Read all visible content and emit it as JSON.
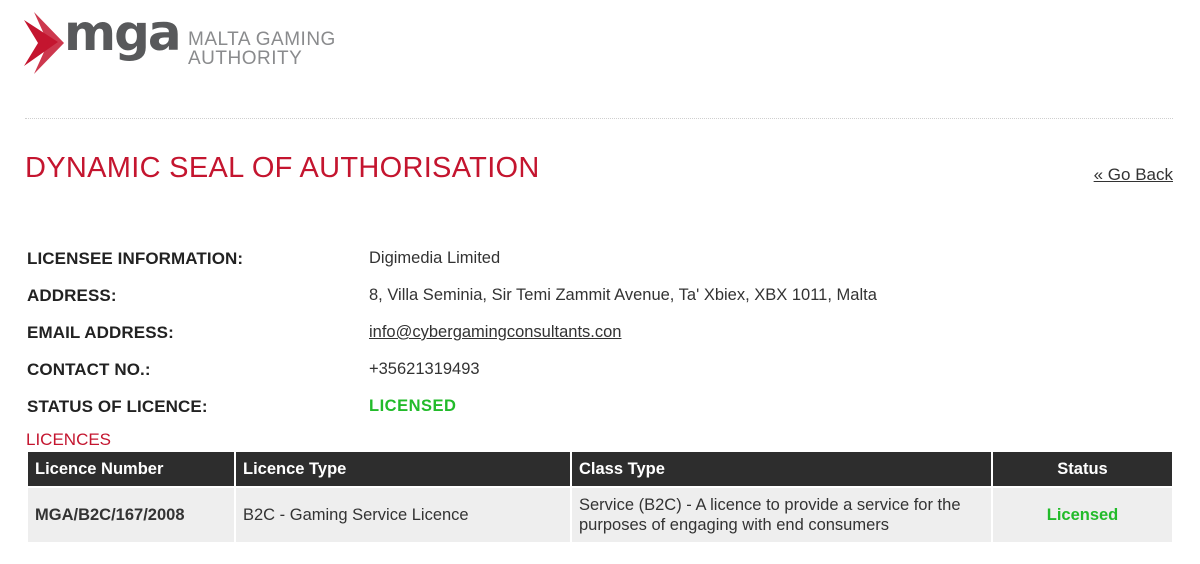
{
  "brand": {
    "logo_mark": "mga",
    "logo_subtitle_line1": "MALTA GAMING",
    "logo_subtitle_line2": "AUTHORITY",
    "accent_color": "#c4152f",
    "status_green": "#22bb2a"
  },
  "page": {
    "title": "DYNAMIC SEAL OF AUTHORISATION",
    "go_back": "« Go Back"
  },
  "info": {
    "licensee_label": "LICENSEE INFORMATION:",
    "licensee_value": "Digimedia Limited",
    "address_label": "ADDRESS:",
    "address_value": "8, Villa Seminia, Sir Temi Zammit Avenue, Ta' Xbiex, XBX 1011, Malta",
    "email_label": "EMAIL ADDRESS:",
    "email_value": "info@cybergamingconsultants.con",
    "contact_label": "CONTACT NO.:",
    "contact_value": "+35621319493",
    "status_label": "STATUS OF LICENCE:",
    "status_value": "LICENSED"
  },
  "licences": {
    "heading": "LICENCES",
    "columns": [
      "Licence Number",
      "Licence Type",
      "Class Type",
      "Status"
    ],
    "rows": [
      {
        "number": "MGA/B2C/167/2008",
        "type": "B2C - Gaming Service Licence",
        "class": "Service (B2C) - A licence to provide a service for the purposes of engaging with end consumers",
        "status": "Licensed"
      }
    ]
  }
}
